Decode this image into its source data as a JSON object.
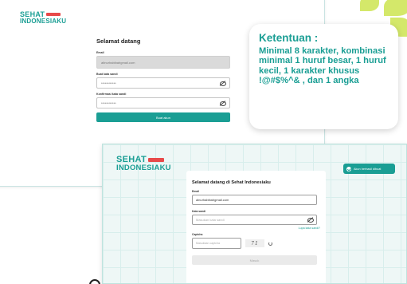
{
  "screen1": {
    "logo": {
      "line1": "SEHAT",
      "line2": "INDONESIAKU"
    },
    "title": "Selamat datang",
    "fields": [
      {
        "label": "Email",
        "value": "altnurhabibahgmail.com",
        "disabled": true
      },
      {
        "label": "Buat kata sandi",
        "value": "************",
        "type": "password"
      },
      {
        "label": "Konfirmasi kata sandi",
        "value": "************",
        "type": "password"
      }
    ],
    "submit_label": "Buat akun"
  },
  "note": {
    "title": "Ketentuan :",
    "body": "Minimal 8 karakter, kombinasi minimal 1 huruf besar, 1 huruf kecil, 1 karakter khusus !@#$%^& , dan 1 angka"
  },
  "screen2": {
    "logo": {
      "line1": "SEHAT",
      "line2": "INDONESIAKU"
    },
    "badge": "Akun berhasil dibuat",
    "title": "Selamat datang di Sehat Indonesiaku",
    "email": {
      "label": "Email",
      "value": "alnurhabibahgmail.com"
    },
    "password": {
      "label": "Kata sandi",
      "placeholder": "Masukan kata sandi"
    },
    "forgot_label": "Lupa kata sandi?",
    "captcha": {
      "label": "Captcha",
      "placeholder": "Masukkan captcha",
      "image_text": "71"
    },
    "submit_label": "Masuk"
  },
  "colors": {
    "brand": "#1a9e94",
    "accent": "#e84a4a",
    "leaf": "#d4e86a"
  }
}
